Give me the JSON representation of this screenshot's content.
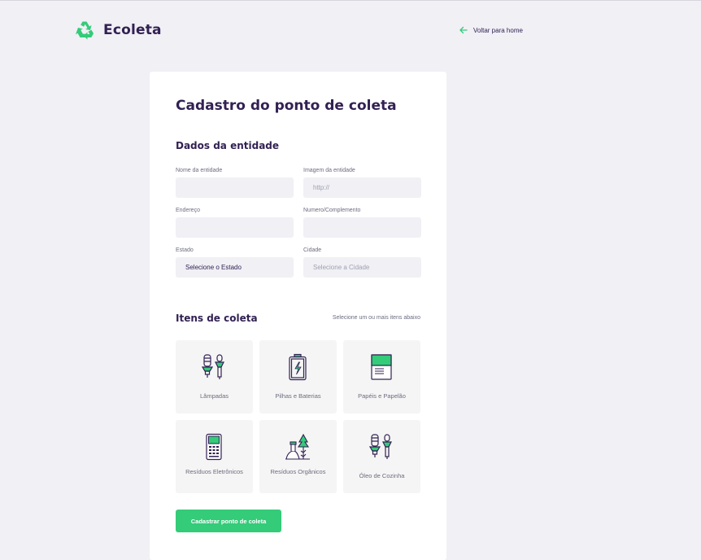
{
  "brand": {
    "name": "Ecoleta",
    "color": "#34cb79",
    "icon": "recycle-icon"
  },
  "header": {
    "back_label": "Voltar para home",
    "back_icon": "arrow-left-icon"
  },
  "form": {
    "title": "Cadastro do ponto de coleta",
    "entity_section": {
      "title": "Dados da entidade",
      "fields": {
        "name": {
          "label": "Nome da entidade",
          "value": "",
          "placeholder": ""
        },
        "image": {
          "label": "Imagem da entidade",
          "value": "",
          "placeholder": "http://"
        },
        "address": {
          "label": "Endereço",
          "value": "",
          "placeholder": ""
        },
        "number": {
          "label": "Numero/Complemento",
          "value": "",
          "placeholder": ""
        },
        "state": {
          "label": "Estado",
          "selected": "Selecione o Estado"
        },
        "city": {
          "label": "Cidade",
          "selected": "Selecione a Cidade"
        }
      }
    },
    "items_section": {
      "title": "Itens de coleta",
      "hint": "Selecione um ou mais itens abaixo",
      "items": [
        {
          "label": "Lâmpadas",
          "icon": "lamps-icon"
        },
        {
          "label": "Pilhas e Baterias",
          "icon": "battery-icon"
        },
        {
          "label": "Papéis e Papelão",
          "icon": "paper-icon"
        },
        {
          "label": "Resíduos Eletrônicos",
          "icon": "electronics-icon"
        },
        {
          "label": "Resíduos Orgânicos",
          "icon": "organic-icon"
        },
        {
          "label": "Óleo de Cozinha",
          "icon": "oil-icon"
        }
      ]
    },
    "submit_label": "Cadastrar ponto de coleta"
  }
}
